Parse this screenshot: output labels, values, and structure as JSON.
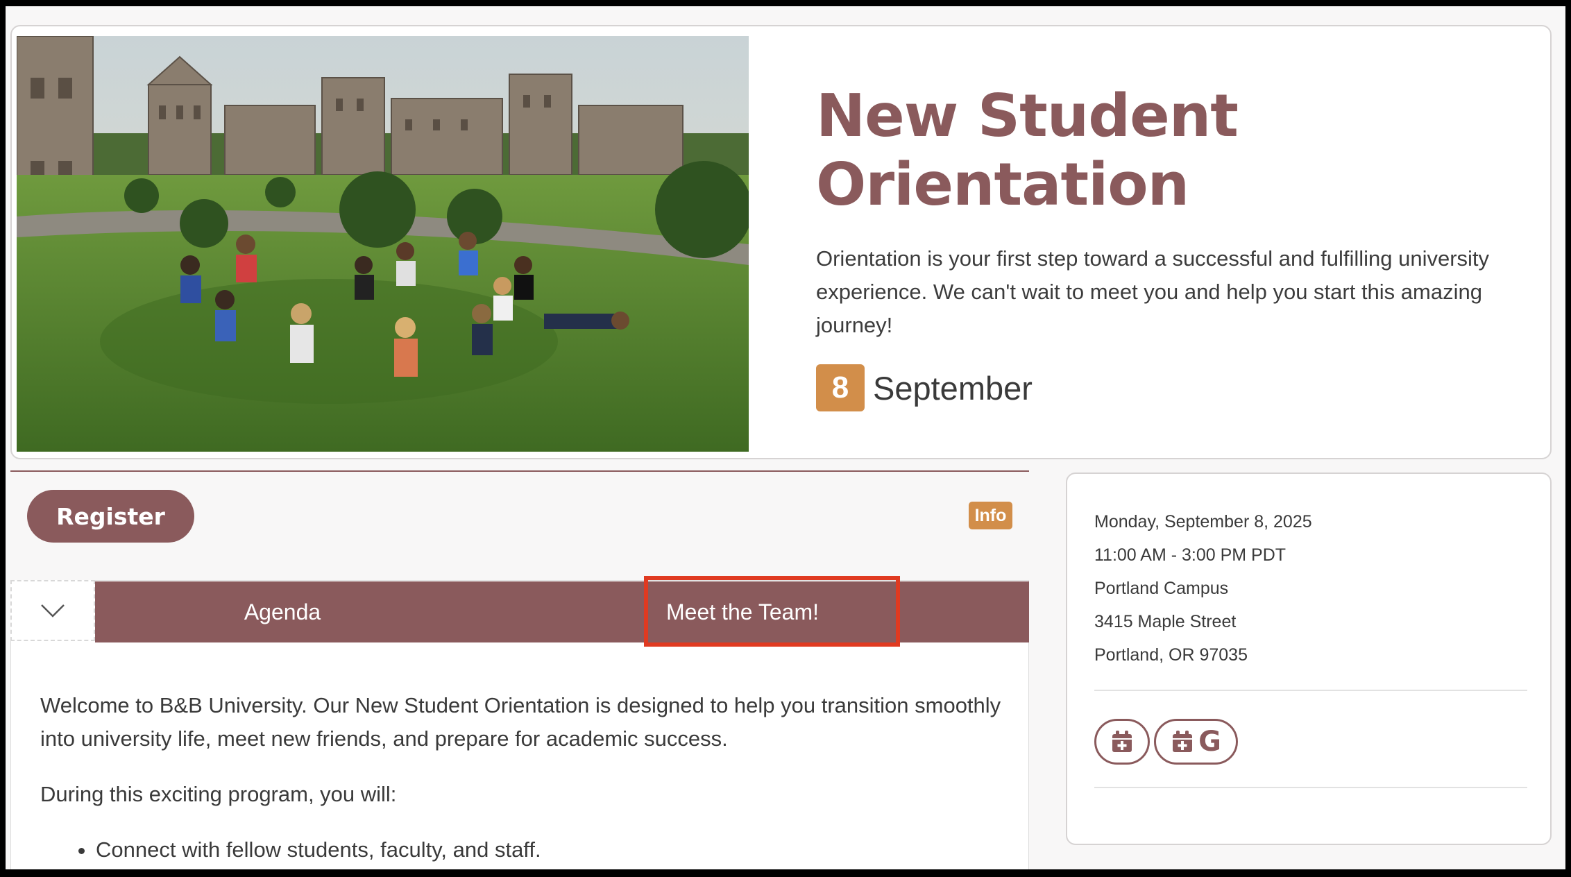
{
  "hero": {
    "title_line1": "New Student",
    "title_line2": "Orientation",
    "description": "Orientation is your first step toward a successful and fulfilling university experience. We can't wait to meet you and help you start this amazing journey!",
    "date_day": "8",
    "date_month": "September",
    "image_alt": "students-sitting-in-circle-on-campus-lawn"
  },
  "actions": {
    "register_label": "Register",
    "info_label": "Info"
  },
  "tabs": [
    {
      "label": "Agenda"
    },
    {
      "label": "Meet the Team!"
    }
  ],
  "content": {
    "paragraph1": "Welcome to B&B University. Our New Student Orientation is designed to help you transition smoothly into university life, meet new friends, and prepare for academic success.",
    "paragraph2": "During this exciting program, you will:",
    "bullets": [
      "Connect with fellow students, faculty, and staff."
    ]
  },
  "event_details": {
    "date": "Monday, September 8, 2025",
    "time": "11:00 AM - 3:00 PM PDT",
    "venue": "Portland Campus",
    "street": "3415 Maple Street",
    "city": "Portland, OR 97035"
  },
  "calendar_buttons": {
    "google_letter": "G",
    "icons": [
      "calendar-plus-icon",
      "google-calendar-icon"
    ]
  },
  "colors": {
    "brand": "#8a5a5c",
    "accent": "#d28e4a",
    "highlight": "#e03a21"
  }
}
